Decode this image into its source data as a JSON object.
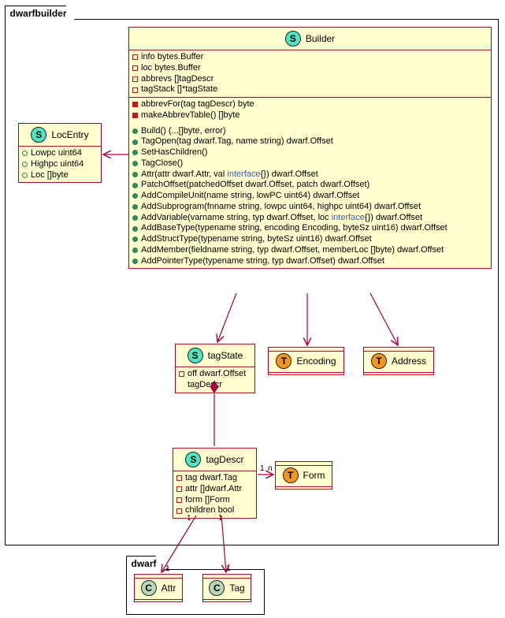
{
  "packages": {
    "outer": "dwarfbuilder",
    "inner": "dwarf"
  },
  "classes": {
    "Builder": {
      "title": "Builder",
      "kind": "S",
      "fields": [
        {
          "v": "priv",
          "t": "info bytes.Buffer"
        },
        {
          "v": "priv",
          "t": "loc bytes.Buffer"
        },
        {
          "v": "priv",
          "t": "abbrevs []tagDescr"
        },
        {
          "v": "priv",
          "t": "tagStack []*tagState"
        }
      ],
      "methods_priv": [
        "abbrevFor(tag tagDescr) byte",
        "makeAbbrevTable() []byte"
      ],
      "methods_pub": [
        {
          "pre": "Build() (...[]byte, error)"
        },
        {
          "pre": "TagOpen(tag dwarf.Tag, name string) dwarf.Offset"
        },
        {
          "pre": "SetHasChildren()"
        },
        {
          "pre": "TagClose()"
        },
        {
          "pre": "Attr(attr dwarf.Attr, val ",
          "kw": "interface",
          "post": "{}) dwarf.Offset"
        },
        {
          "pre": "PatchOffset(patchedOffset dwarf.Offset, patch dwarf.Offset)"
        },
        {
          "pre": "AddCompileUnit(name string, lowPC uint64) dwarf.Offset"
        },
        {
          "pre": "AddSubprogram(fnname string, lowpc uint64, highpc uint64) dwarf.Offset"
        },
        {
          "pre": "AddVariable(varname string, typ dwarf.Offset, loc ",
          "kw": "interface",
          "post": "{}) dwarf.Offset"
        },
        {
          "pre": "AddBaseType(typename string, encoding Encoding, byteSz uint16) dwarf.Offset"
        },
        {
          "pre": "AddStructType(typename string, byteSz uint16) dwarf.Offset"
        },
        {
          "pre": "AddMember(fieldname string, typ dwarf.Offset, memberLoc []byte) dwarf.Offset"
        },
        {
          "pre": "AddPointerType(typename string, typ dwarf.Offset) dwarf.Offset"
        }
      ]
    },
    "LocEntry": {
      "title": "LocEntry",
      "kind": "S",
      "fields": [
        {
          "v": "pub",
          "t": "Lowpc uint64"
        },
        {
          "v": "pub",
          "t": "Highpc uint64"
        },
        {
          "v": "pub",
          "t": "Loc []byte"
        }
      ]
    },
    "tagState": {
      "title": "tagState",
      "kind": "S",
      "fields": [
        {
          "v": "priv",
          "t": "off dwarf.Offset"
        },
        {
          "v": "none",
          "t": "tagDescr"
        }
      ]
    },
    "tagDescr": {
      "title": "tagDescr",
      "kind": "S",
      "fields": [
        {
          "v": "priv",
          "t": "tag dwarf.Tag"
        },
        {
          "v": "priv",
          "t": "attr []dwarf.Attr"
        },
        {
          "v": "priv",
          "t": "form []Form"
        },
        {
          "v": "priv",
          "t": "children bool"
        }
      ]
    },
    "Encoding": {
      "title": "Encoding",
      "kind": "T"
    },
    "Address": {
      "title": "Address",
      "kind": "T"
    },
    "Form": {
      "title": "Form",
      "kind": "T"
    },
    "Attr": {
      "title": "Attr",
      "kind": "C"
    },
    "Tag": {
      "title": "Tag",
      "kind": "C"
    }
  },
  "cardinalities": {
    "form_1": "1",
    "form_n": "n",
    "attr_1a": "1",
    "attr_1b": "1",
    "tag_1a": "1",
    "tag_1b": "1"
  }
}
